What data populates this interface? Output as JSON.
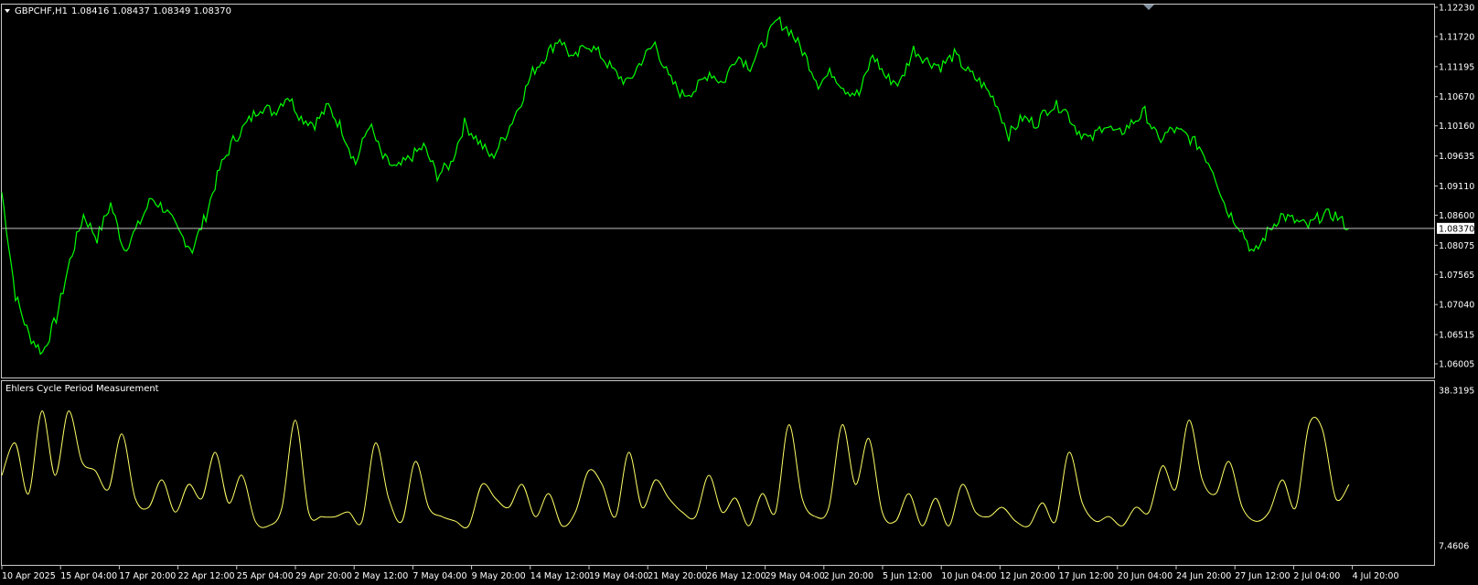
{
  "symbol_header": {
    "symbol": "GBPCHF,H1",
    "ohlc": "1.08416 1.08437 1.08349 1.08370"
  },
  "colors": {
    "background": "#000000",
    "frame": "#c8c8c8",
    "price_line": "#00ff00",
    "indicator_line": "#ffff66",
    "current_price_line": "#c0c0c0",
    "price_box_bg": "#ffffff"
  },
  "indicator": {
    "title": "Ehlers Cycle Period Measurement"
  },
  "current_price": "1.08370",
  "chart_data": [
    {
      "type": "line",
      "title": "GBPCHF,H1",
      "ylim": [
        1.06005,
        1.1223
      ],
      "y_ticks": [
        "1.12230",
        "1.11720",
        "1.11195",
        "1.10670",
        "1.10160",
        "1.09635",
        "1.09110",
        "1.08600",
        "1.08075",
        "1.07565",
        "1.07040",
        "1.06515",
        "1.06005"
      ],
      "x_ticks": [
        "10 Apr 2025",
        "15 Apr 04:00",
        "17 Apr 20:00",
        "22 Apr 12:00",
        "25 Apr 04:00",
        "29 Apr 20:00",
        "2 May 12:00",
        "7 May 04:00",
        "9 May 20:00",
        "14 May 12:00",
        "19 May 04:00",
        "21 May 20:00",
        "26 May 12:00",
        "29 May 04:00",
        "2 Jun 20:00",
        "5 Jun 12:00",
        "10 Jun 04:00",
        "12 Jun 20:00",
        "17 Jun 12:00",
        "20 Jun 04:00",
        "24 Jun 20:00",
        "27 Jun 12:00",
        "2 Jul 04:00",
        "4 Jul 20:00"
      ],
      "series": [
        {
          "values": [
            1.09,
            1.072,
            1.065,
            1.062,
            1.068,
            1.078,
            1.086,
            1.082,
            1.088,
            1.08,
            1.084,
            1.089,
            1.087,
            1.083,
            1.08,
            1.086,
            1.094,
            1.099,
            1.102,
            1.105,
            1.104,
            1.107,
            1.103,
            1.102,
            1.105,
            1.101,
            1.095,
            1.102,
            1.096,
            1.094,
            1.096,
            1.098,
            1.093,
            1.095,
            1.102,
            1.099,
            1.096,
            1.1,
            1.105,
            1.111,
            1.114,
            1.117,
            1.113,
            1.116,
            1.114,
            1.111,
            1.109,
            1.113,
            1.116,
            1.11,
            1.107,
            1.108,
            1.111,
            1.109,
            1.114,
            1.112,
            1.116,
            1.12,
            1.118,
            1.114,
            1.109,
            1.111,
            1.108,
            1.107,
            1.114,
            1.11,
            1.109,
            1.115,
            1.113,
            1.112,
            1.114,
            1.111,
            1.109,
            1.106,
            1.1,
            1.103,
            1.102,
            1.105,
            1.105,
            1.101,
            1.099,
            1.102,
            1.1,
            1.102,
            1.104,
            1.099,
            1.101,
            1.1,
            1.098,
            1.094,
            1.087,
            1.084,
            1.079,
            1.083,
            1.086,
            1.085,
            1.084,
            1.086,
            1.086,
            1.0837
          ]
        }
      ]
    },
    {
      "type": "line",
      "title": "Ehlers Cycle Period Measurement",
      "ylim": [
        7.4606,
        38.3195
      ],
      "y_ticks": [
        "38.3195",
        "7.4606"
      ],
      "series": [
        {
          "values": [
            22,
            29,
            18,
            36,
            22,
            36,
            25,
            23,
            19,
            31,
            17,
            15,
            21,
            14,
            20,
            17,
            27,
            16,
            22,
            12,
            11,
            15,
            34,
            14,
            13,
            13,
            14,
            12,
            29,
            17,
            12,
            25,
            15,
            13,
            12,
            11,
            20,
            17,
            15,
            20,
            13,
            18,
            11,
            14,
            23,
            20,
            13,
            27,
            15,
            21,
            17,
            14,
            13,
            22,
            14,
            17,
            11,
            18,
            14,
            33,
            17,
            13,
            15,
            33,
            20,
            30,
            14,
            12,
            18,
            11,
            17,
            11,
            20,
            14,
            13,
            15,
            12,
            11,
            16,
            12,
            27,
            16,
            12,
            13,
            11,
            15,
            14,
            24,
            19,
            34,
            21,
            18,
            25,
            15,
            12,
            14,
            21,
            15,
            33,
            32,
            17,
            20
          ]
        }
      ]
    }
  ]
}
